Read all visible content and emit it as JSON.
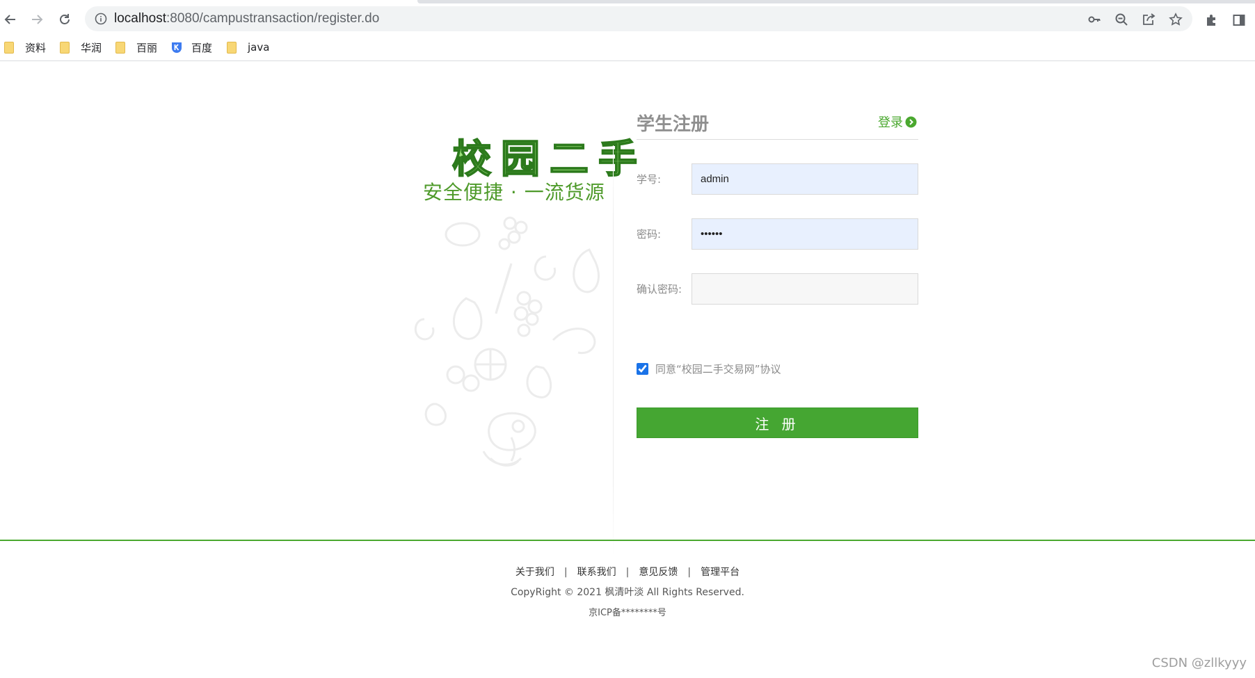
{
  "browser": {
    "url_host": "localhost",
    "url_path": ":8080/campustransaction/register.do",
    "bookmarks": [
      {
        "label": "资料",
        "icon": "folder-icon"
      },
      {
        "label": "华润",
        "icon": "folder-icon"
      },
      {
        "label": "百丽",
        "icon": "folder-icon"
      },
      {
        "label": "百度",
        "icon": "k-logo-icon"
      },
      {
        "label": "java",
        "icon": "folder-icon"
      }
    ]
  },
  "brand": {
    "title": "校园二手",
    "subtitle": "安全便捷 · 一流货源",
    "title_color": "#9be07b",
    "subtitle_color": "#4e9a2a"
  },
  "form": {
    "title": "学生注册",
    "login_link": "登录",
    "student_id_label": "学号:",
    "student_id_value": "admin",
    "password_label": "密码:",
    "password_value": "123456",
    "confirm_label": "确认密码:",
    "confirm_value": "",
    "agree_text": "同意“校园二手交易网”协议",
    "agree_checked": true,
    "submit_label": "注 册"
  },
  "footer": {
    "links": [
      "关于我们",
      "联系我们",
      "意见反馈",
      "管理平台"
    ],
    "copyright": "CopyRight © 2021 枫清叶淡 All Rights Reserved.",
    "icp": "京ICP备********号"
  },
  "watermark": "CSDN @zllkyyy",
  "colors": {
    "accent_green": "#45a632",
    "autofill_bg": "#e8f0fe"
  }
}
